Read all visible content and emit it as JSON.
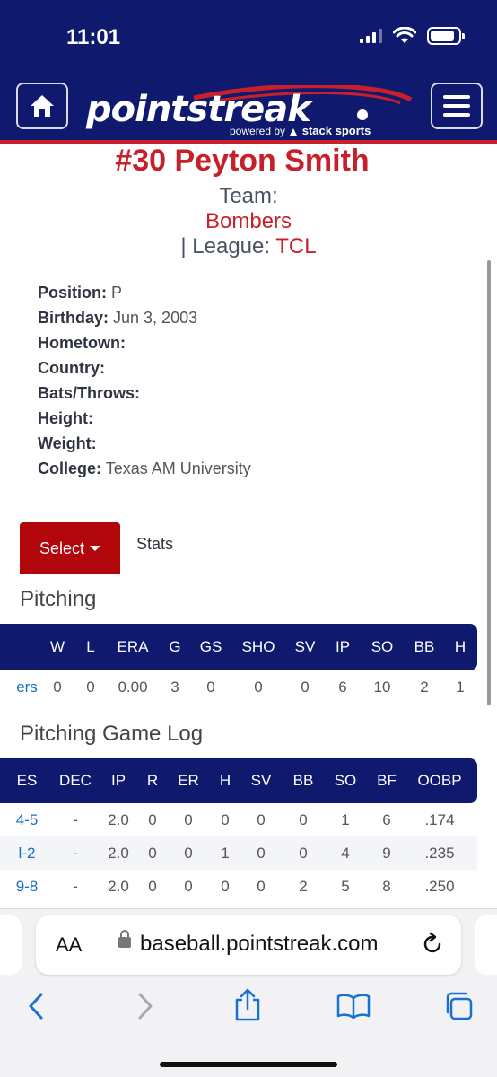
{
  "status_bar": {
    "time": "11:01"
  },
  "header": {
    "logo_text": "pointstreak",
    "powered_by": "powered by",
    "partner": "stack sports"
  },
  "player": {
    "name": "#30 Peyton Smith",
    "team_label": "Team:",
    "team": "Bombers",
    "league_prefix": "| League:",
    "league": "TCL"
  },
  "bio": [
    {
      "label": "Position:",
      "value": " P"
    },
    {
      "label": "Birthday:",
      "value": " Jun 3, 2003"
    },
    {
      "label": "Hometown:",
      "value": ""
    },
    {
      "label": "Country:",
      "value": ""
    },
    {
      "label": "Bats/Throws:",
      "value": ""
    },
    {
      "label": "Height:",
      "value": ""
    },
    {
      "label": "Weight:",
      "value": ""
    },
    {
      "label": "College:",
      "value": " Texas AM University"
    }
  ],
  "tabs": {
    "select": "Select",
    "stats": "Stats"
  },
  "pitching": {
    "title": "Pitching",
    "headers": [
      "W",
      "L",
      "ERA",
      "G",
      "GS",
      "SHO",
      "SV",
      "IP",
      "SO",
      "BB",
      "H"
    ],
    "row": {
      "team": "ers",
      "values": [
        "0",
        "0",
        "0.00",
        "3",
        "0",
        "0",
        "0",
        "6",
        "10",
        "2",
        "1"
      ]
    }
  },
  "game_log": {
    "title": "Pitching Game Log",
    "headers": [
      "ES",
      "DEC",
      "IP",
      "R",
      "ER",
      "H",
      "SV",
      "BB",
      "SO",
      "BF",
      "OOBP"
    ],
    "rows": [
      [
        "4-5",
        "-",
        "2.0",
        "0",
        "0",
        "0",
        "0",
        "0",
        "1",
        "6",
        ".174"
      ],
      [
        "l-2",
        "-",
        "2.0",
        "0",
        "0",
        "1",
        "0",
        "0",
        "4",
        "9",
        ".235"
      ],
      [
        "9-8",
        "-",
        "2.0",
        "0",
        "0",
        "0",
        "0",
        "2",
        "5",
        "8",
        ".250"
      ]
    ]
  },
  "browser": {
    "aa_label": "AA",
    "url": "baseball.pointstreak.com"
  },
  "colors": {
    "navy": "#0f1a6e",
    "red": "#c8202a",
    "select_red": "#b0060c",
    "link": "#1a6fc4"
  }
}
